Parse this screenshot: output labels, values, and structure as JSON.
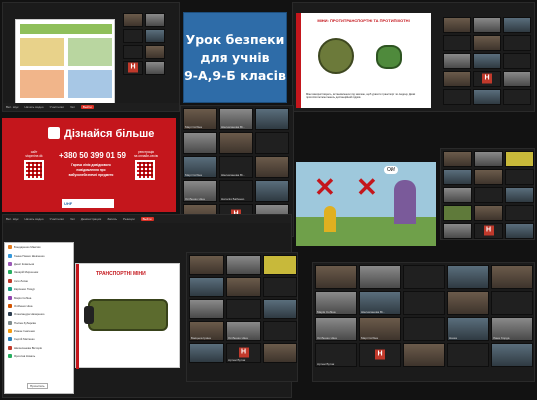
{
  "title_card": {
    "line1": "Урок безпеки",
    "line2": "для учнів",
    "line3": "9-А,9-Б класів"
  },
  "info_slide": {
    "heading": "Дізнайся більше",
    "phone": "+380 50 399 01 59",
    "hotline": "Гаряча лінія довідкового",
    "hotline2": "повідомлення про",
    "hotline3": "вибухонебезпечні предмети",
    "site_label": "сайт",
    "site": "stopmine.dk",
    "register_label": "реєстрація",
    "register": "на онлайн-сесію",
    "footer": "UHF"
  },
  "mine_slide": {
    "title": "МІНИ: ПРОТИТРАНСПОРТНІ ТА ПРОТИПІХОТНІ",
    "text": "Міни використовують, встановлюючи під землею, щоб уразити транспорт чи людину. Деякі протипіхотні міни мають дистанційний підрив."
  },
  "transport_slide": {
    "title": "ТРАНСПОРТНІ МІНИ"
  },
  "comic_slide": {
    "bubble": "Ой!"
  },
  "participants": [
    "Марі Собіна",
    "Шелюпанова Ві...",
    "Олібенко Ніна",
    "Наталія Бабенко",
    "Артем Бутак",
    "Хардаєнко Кате...",
    "Баєцька Ірина",
    "Стрілець Христ...",
    "Марія Собіна",
    "Наша",
    "Лана Хорда"
  ],
  "avatar_letter": "Н",
  "chat_list": [
    "Бондаренко Максим",
    "Ганна Пашко Шевченко",
    "Деніс Ковальов",
    "Захарій Мирошник",
    "Ілля Лисак",
    "Карпенко Тимур",
    "Марія Собіна",
    "Олібенко Ніна",
    "Олександра Назаренко",
    "Поліна Зубарєва",
    "Роман Ігнатенко",
    "Сергій Матієнко",
    "Шелюпанова Вікторія",
    "Ярослав Коваль"
  ],
  "chat_button": "Прочитать",
  "toolbar": {
    "mute": "Вкл. звук",
    "video": "Начать видео",
    "participants": "Участники",
    "chat": "Чат",
    "share": "Демонстрация",
    "record": "Запись",
    "reactions": "Реакции",
    "end": "Выйти"
  },
  "colors": {
    "title_bg": "#2e6ca8",
    "info_bg": "#c4161c",
    "end_button": "#d93025"
  }
}
